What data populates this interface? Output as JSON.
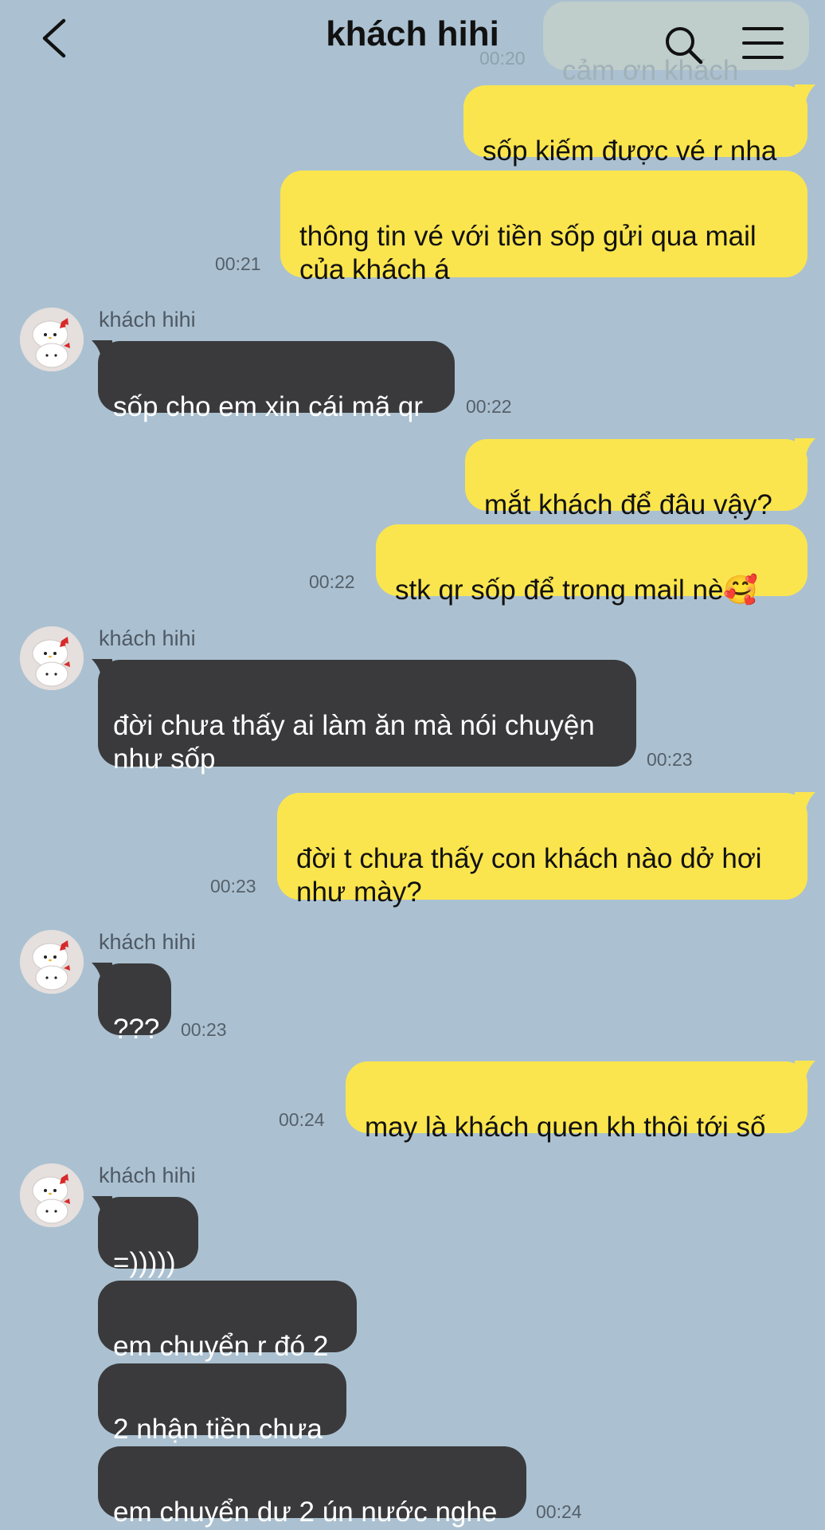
{
  "header": {
    "title": "khách hihi",
    "back_icon": "chevron-left-icon",
    "search_icon": "search-icon",
    "menu_icon": "hamburger-menu-icon"
  },
  "faded_preview": {
    "text": "cảm ơn khách",
    "time": "00:20"
  },
  "colors": {
    "background": "#abc1d1",
    "outgoing": "#fbe54e",
    "incoming": "#3a3a3c"
  },
  "messages": [
    {
      "text": "sốp kiếm được vé r nha"
    },
    {
      "text": "thông tin vé với tiền sốp gửi qua mail\ncủa khách á",
      "time": "00:21"
    },
    {
      "sender": "khách hihi",
      "text": "sốp cho em xin cái mã qr",
      "time": "00:22"
    },
    {
      "text": "mắt khách để đâu vậy?"
    },
    {
      "text": "stk qr sốp để trong mail nè🥰",
      "time": "00:22"
    },
    {
      "sender": "khách hihi",
      "text": "đời chưa thấy ai làm ăn mà nói chuyện\nnhư sốp",
      "time": "00:23"
    },
    {
      "text": "đời t chưa thấy con khách nào dở hơi\nnhư mày?",
      "time": "00:23"
    },
    {
      "sender": "khách hihi",
      "text": "???",
      "time": "00:23"
    },
    {
      "text": "may là khách quen kh thôi tới số",
      "time": "00:24"
    },
    {
      "sender": "khách hihi",
      "text": "=)))))"
    },
    {
      "text": "em chuyển r đó 2"
    },
    {
      "text": "2 nhận tiền chưa"
    },
    {
      "text": "em chuyển dư 2 ún nước nghe",
      "time": "00:24"
    }
  ]
}
